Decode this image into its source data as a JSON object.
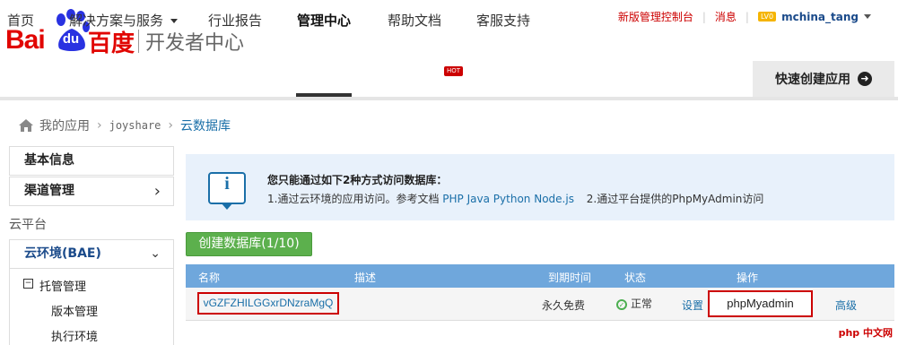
{
  "brand": {
    "logo_left": "Bai",
    "logo_du": "du",
    "logo_cn": "百度",
    "product": "开发者中心"
  },
  "top_links": {
    "console": "新版管理控制台",
    "messages": "消息",
    "level": "LV0",
    "username": "mchina_tang"
  },
  "nav": {
    "items": [
      "首页",
      "解决方案与服务",
      "行业报告",
      "管理中心",
      "帮助文档",
      "客服支持"
    ],
    "hot_badge": "HOT",
    "quick_create": "快速创建应用"
  },
  "breadcrumb": [
    "我的应用",
    "joyshare",
    "云数据库"
  ],
  "sidebar": {
    "basic_info": "基本信息",
    "channel_mgmt": "渠道管理",
    "category": "云平台",
    "cloud_env": "云环境(BAE)",
    "hosting": "托管管理",
    "version": "版本管理",
    "runtime": "执行环境"
  },
  "info": {
    "title": "您只能通过如下2种方式访问数据库：",
    "line1_prefix": "1.通过云环境的应用访问。参考文档",
    "doc_links": [
      "PHP",
      "Java",
      "Python",
      "Node.js"
    ],
    "line2": "2.通过平台提供的PhpMyAdmin访问"
  },
  "create_button": "创建数据库(1/10)",
  "table": {
    "headers": {
      "name": "名称",
      "desc": "描述",
      "expire": "到期时间",
      "status": "状态",
      "actions": "操作"
    },
    "rows": [
      {
        "name": "vGZFZHILGGxrDNzraMgQ",
        "desc": "",
        "expire": "永久免费",
        "status": "正常",
        "settings": "设置",
        "pma": "phpMyadmin",
        "advanced": "高级"
      }
    ]
  },
  "watermark": "php 中文网"
}
